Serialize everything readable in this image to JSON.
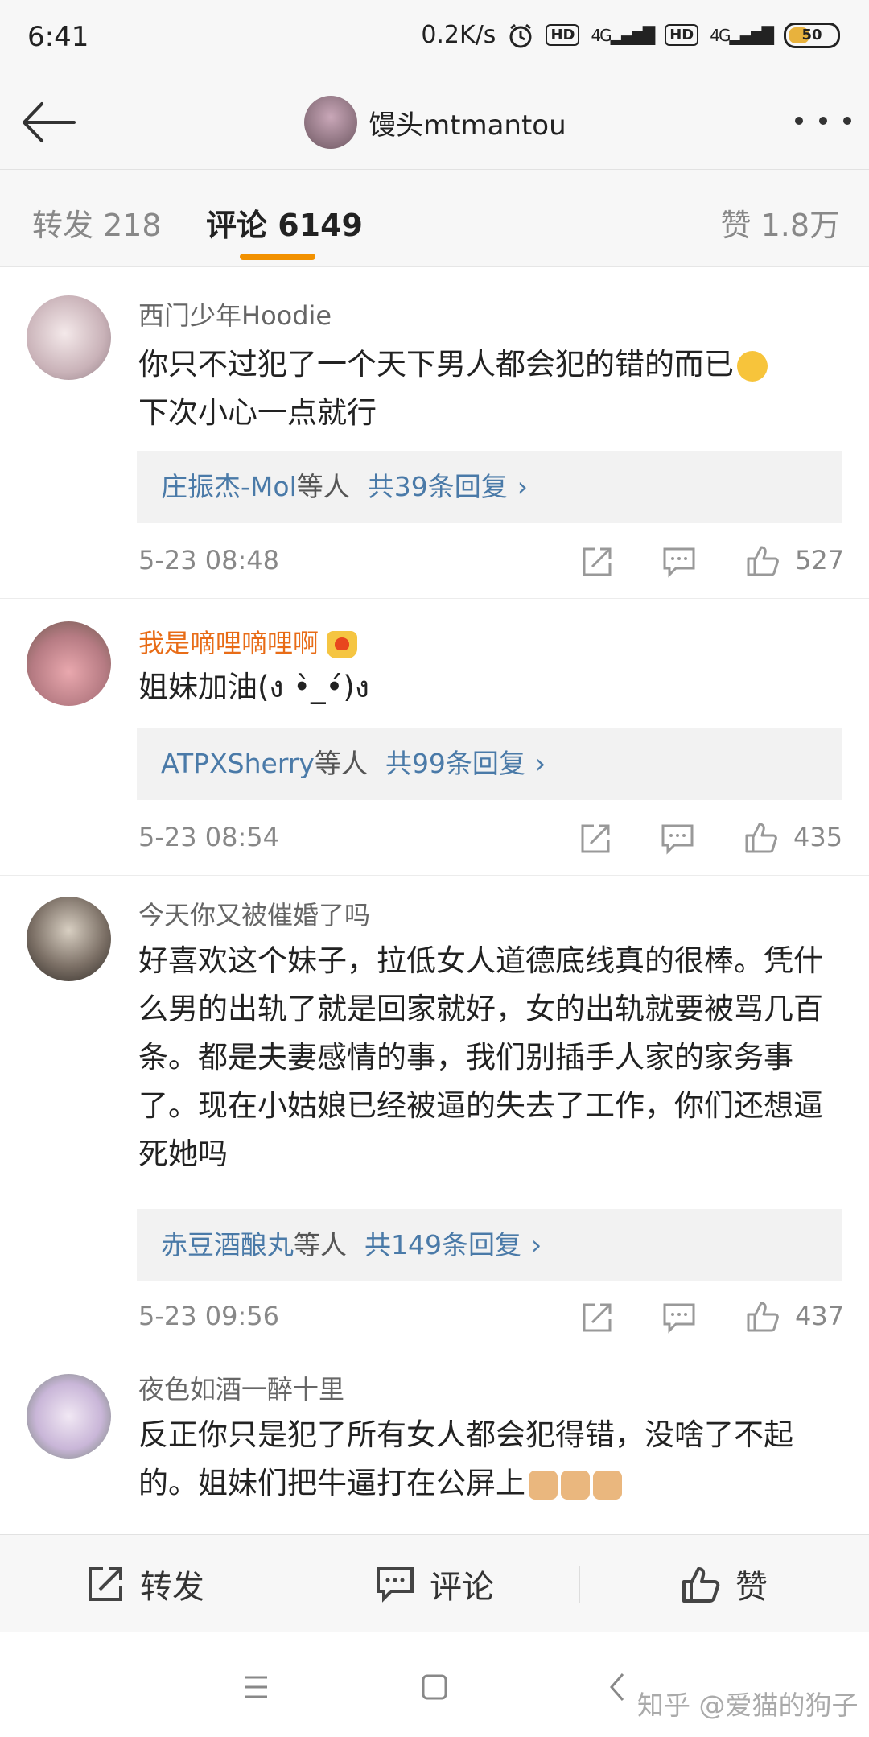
{
  "status": {
    "time": "6:41",
    "speed": "0.2K/s",
    "hd": "HD",
    "net": "4G",
    "battery": "50"
  },
  "topbar": {
    "title": "馒头mtmantou"
  },
  "tabs": {
    "repost": "转发 218",
    "comments": "评论 6149",
    "likes": "赞 1.8万"
  },
  "comments": [
    {
      "name": "西门少年Hoodie",
      "text_line1": "你只不过犯了一个天下男人都会犯的错的而已",
      "text_line2": "下次小心一点就行",
      "reply_users": "庄振杰-Mol",
      "reply_etc": "等人",
      "reply_count": "共39条回复",
      "time": "5-23 08:48",
      "likes": "527"
    },
    {
      "name": "我是嘀哩嘀哩啊",
      "text": "姐妹加油(ง •̀_•́)ง",
      "reply_users": "ATPXSherry",
      "reply_etc": "等人",
      "reply_count": "共99条回复",
      "time": "5-23 08:54",
      "likes": "435"
    },
    {
      "name": "今天你又被催婚了吗",
      "text": "好喜欢这个妹子，拉低女人道德底线真的很棒。凭什么男的出轨了就是回家就好，女的出轨就要被骂几百条。都是夫妻感情的事，我们别插手人家的家务事了。现在小姑娘已经被逼的失去了工作，你们还想逼死她吗",
      "reply_users": "赤豆酒酿丸",
      "reply_etc": "等人",
      "reply_count": "共149条回复",
      "time": "5-23 09:56",
      "likes": "437"
    },
    {
      "name": "夜色如酒一醉十里",
      "text": "反正你只是犯了所有女人都会犯得错，没啥了不起的。姐妹们把牛逼打在公屏上"
    }
  ],
  "reply_chevron": "›",
  "bottom": {
    "repost": "转发",
    "comment": "评论",
    "like": "赞"
  },
  "watermark": "知乎 @爱猫的狗子",
  "colors": {
    "accent": "#f29100",
    "link": "#4a7aa8",
    "vip_name": "#e86c17"
  },
  "icons": [
    "back-arrow-icon",
    "more-icon",
    "share-icon",
    "comment-icon",
    "like-icon",
    "menu-icon",
    "home-icon",
    "back-icon"
  ]
}
